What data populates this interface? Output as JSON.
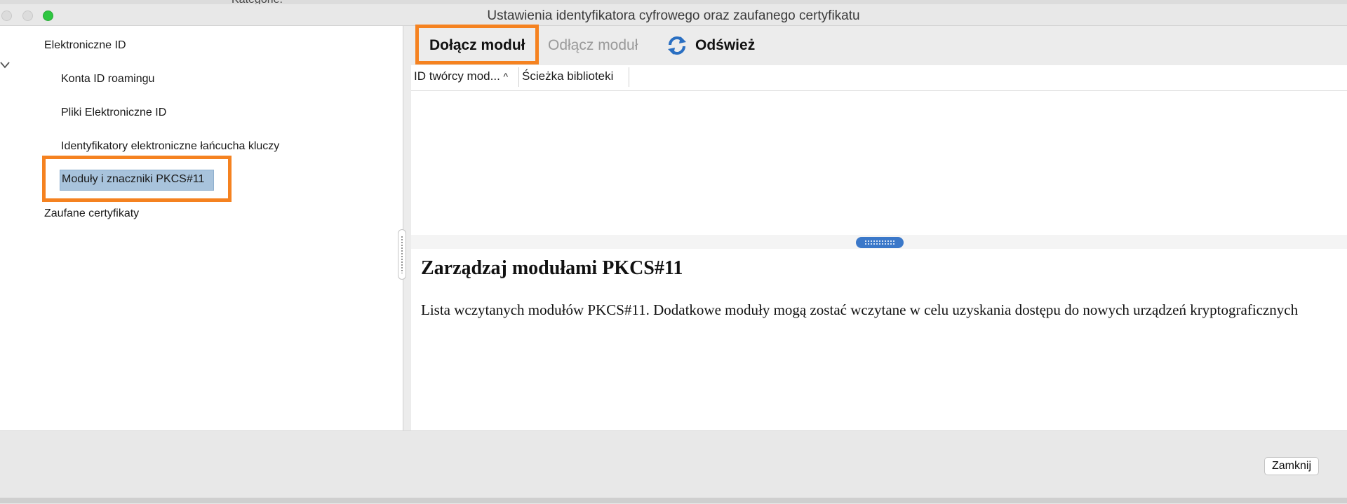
{
  "background": {
    "partial_text": "Kategorie:"
  },
  "window": {
    "title": "Ustawienia identyfikatora cyfrowego oraz zaufanego certyfikatu"
  },
  "sidebar": {
    "items": [
      {
        "label": "Elektroniczne ID"
      },
      {
        "label": "Konta ID roamingu"
      },
      {
        "label": "Pliki Elektroniczne ID"
      },
      {
        "label": "Identyfikatory elektroniczne łańcucha kluczy"
      },
      {
        "label": "Moduły i znaczniki PKCS#11",
        "selected": true
      },
      {
        "label": "Zaufane certyfikaty"
      }
    ]
  },
  "toolbar": {
    "attach_label": "Dołącz moduł",
    "detach_label": "Odłącz moduł",
    "refresh_label": "Odśwież"
  },
  "table": {
    "columns": [
      "ID twórcy mod...",
      "Ścieżka biblioteki"
    ],
    "rows": []
  },
  "description": {
    "title": "Zarządzaj modułami PKCS#11",
    "text": "Lista wczytanych modułów PKCS#11. Dodatkowe moduły mogą zostać wczytane w celu uzyskania dostępu do nowych urządzeń kryptograficznych"
  },
  "footer": {
    "close_label": "Zamknij"
  },
  "colors": {
    "highlight": "#f58220",
    "selection": "#a8c3dc",
    "refresh_icon": "#2a6fc2"
  }
}
